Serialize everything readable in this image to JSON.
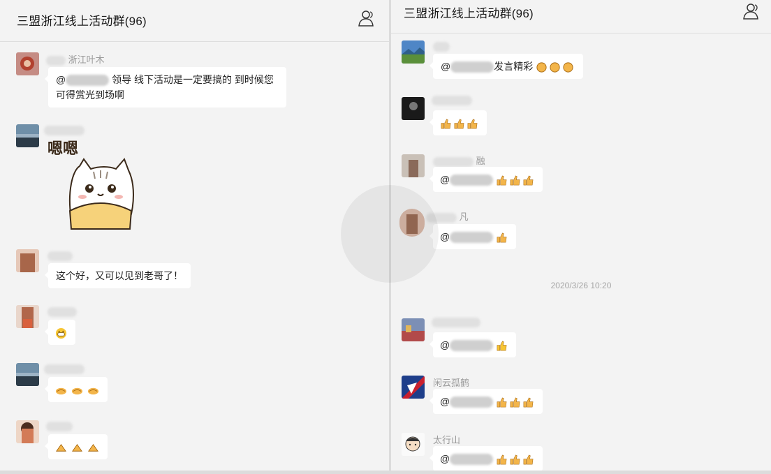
{
  "left": {
    "title": "三盟浙江线上活动群(96)",
    "messages": [
      {
        "sender": "浙江叶木",
        "text_pre": "@",
        "text_post": " 领导 线下活动是一定要搞的 到时候您",
        "text_line2": "可得赏光到场啊"
      },
      {
        "sticker_text": "嗯嗯"
      },
      {
        "text": "这个好，又可以见到老哥了！"
      },
      {
        "emoji": "grin-icon"
      },
      {
        "emoji": "handshake-icon"
      },
      {
        "emoji": "thumb-icon"
      }
    ]
  },
  "right": {
    "title": "三盟浙江线上活动群(96)",
    "messages": [
      {
        "text_pre": "@",
        "text_post": "发言精彩"
      },
      {
        "emoji": "thumbs-up-icon"
      },
      {
        "sender": "融",
        "text_pre": "@"
      },
      {
        "sender": "凡",
        "text_pre": "@"
      },
      {
        "text_pre": "@"
      },
      {
        "sender": "闲云孤鹤",
        "text_pre": "@"
      },
      {
        "sender": "太行山",
        "text_pre": "@"
      }
    ],
    "timestamp": "2020/3/26 10:20"
  },
  "colors": {
    "background": "#f3f3f3",
    "bubble": "#ffffff",
    "name": "#9a9a9a"
  }
}
